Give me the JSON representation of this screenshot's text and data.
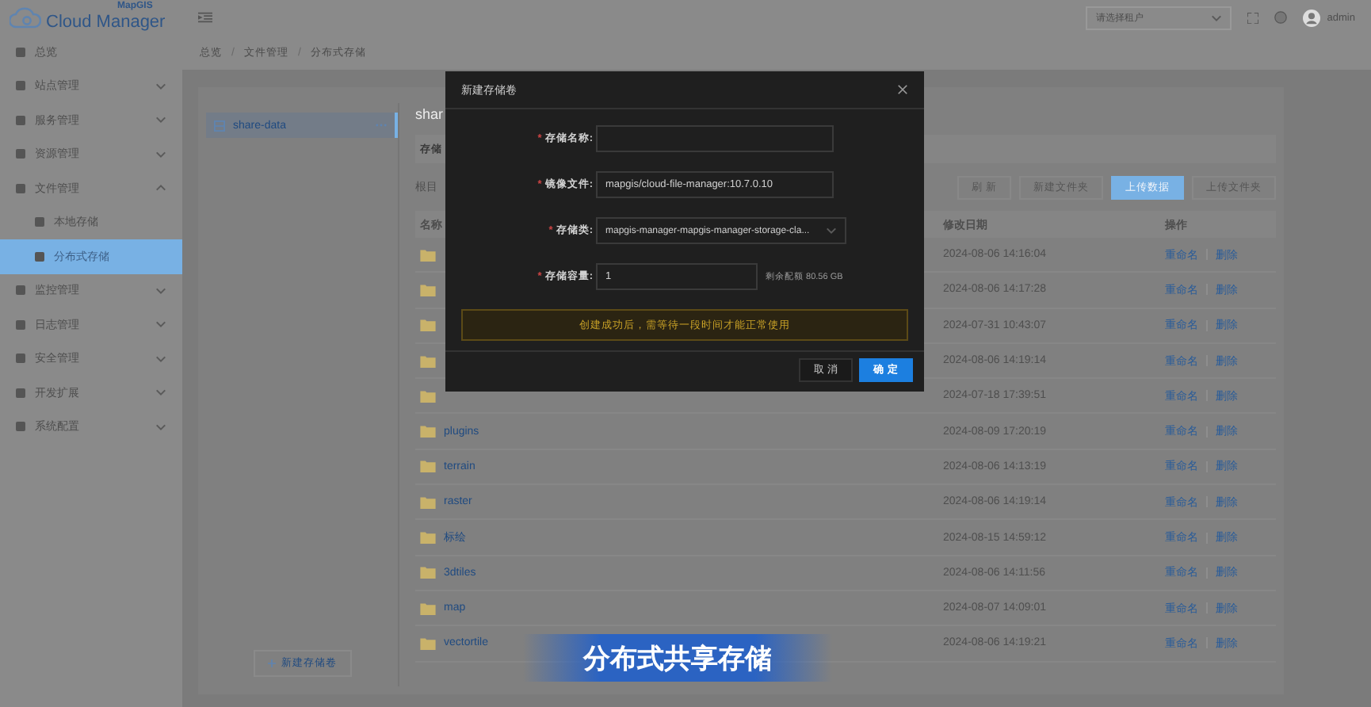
{
  "header": {
    "logo_small": "MapGIS",
    "logo": "Cloud Manager",
    "tenant_select": {
      "placeholder": "请选择租户"
    },
    "user": "admin"
  },
  "breadcrumb": [
    {
      "kind": "item",
      "text": "总览"
    },
    {
      "kind": "separator",
      "text": "/"
    },
    {
      "kind": "item",
      "text": "文件管理"
    },
    {
      "kind": "separator",
      "text": "/"
    },
    {
      "kind": "item",
      "text": "分布式存储"
    }
  ],
  "sidebar": {
    "items": [
      {
        "kind": "link",
        "label": "总览",
        "selected": false
      },
      {
        "kind": "group",
        "label": "站点管理",
        "expanded": false,
        "selected": false
      },
      {
        "kind": "group",
        "label": "服务管理",
        "expanded": false,
        "selected": false
      },
      {
        "kind": "group",
        "label": "资源管理",
        "expanded": false,
        "selected": false
      },
      {
        "kind": "group",
        "label": "文件管理",
        "expanded": true,
        "selected": false,
        "children": [
          {
            "label": "本地存储",
            "selected": false
          },
          {
            "label": "分布式存储",
            "selected": true
          }
        ]
      },
      {
        "kind": "group",
        "label": "监控管理",
        "expanded": false,
        "selected": false
      },
      {
        "kind": "group",
        "label": "日志管理",
        "expanded": false,
        "selected": false
      },
      {
        "kind": "group",
        "label": "安全管理",
        "expanded": false,
        "selected": false
      },
      {
        "kind": "group",
        "label": "开发扩展",
        "expanded": false,
        "selected": false
      },
      {
        "kind": "group",
        "label": "系统配置",
        "expanded": false,
        "selected": false
      }
    ]
  },
  "storage_list": {
    "items": [
      {
        "name": "share-data",
        "selected": true
      }
    ],
    "add_button": "新建存储卷"
  },
  "content": {
    "title": "shar",
    "tab": "存储",
    "path": "根目",
    "buttons": [
      {
        "label": "刷 新",
        "primary": false
      },
      {
        "label": "新建文件夹",
        "primary": false
      },
      {
        "label": "上传数据",
        "primary": true
      },
      {
        "label": "上传文件夹",
        "primary": false
      }
    ],
    "columns": [
      "名称",
      "修改日期",
      "操作"
    ],
    "rows": [
      {
        "modified": "2024-08-06 14:16:04",
        "actions": [
          "重命名",
          "删除"
        ]
      },
      {
        "modified": "2024-08-06 14:17:28",
        "actions": [
          "重命名",
          "删除"
        ]
      },
      {
        "modified": "2024-07-31 10:43:07",
        "actions": [
          "重命名",
          "删除"
        ]
      },
      {
        "modified": "2024-08-06 14:19:14",
        "actions": [
          "重命名",
          "删除"
        ]
      },
      {
        "modified": "2024-07-18 17:39:51",
        "actions": [
          "重命名",
          "删除"
        ]
      },
      {
        "name": "plugins",
        "modified": "2024-08-09 17:20:19",
        "actions": [
          "重命名",
          "删除"
        ]
      },
      {
        "name": "terrain",
        "modified": "2024-08-06 14:13:19",
        "actions": [
          "重命名",
          "删除"
        ]
      },
      {
        "name": "raster",
        "modified": "2024-08-06 14:19:14",
        "actions": [
          "重命名",
          "删除"
        ]
      },
      {
        "name": "标绘",
        "modified": "2024-08-15 14:59:12",
        "actions": [
          "重命名",
          "删除"
        ]
      },
      {
        "name": "3dtiles",
        "modified": "2024-08-06 14:11:56",
        "actions": [
          "重命名",
          "删除"
        ]
      },
      {
        "name": "map",
        "modified": "2024-08-07 14:09:01",
        "actions": [
          "重命名",
          "删除"
        ]
      },
      {
        "name": "vectortile",
        "modified": "2024-08-06 14:19:21",
        "actions": [
          "重命名",
          "删除"
        ]
      }
    ]
  },
  "dialog": {
    "title": "新建存储卷",
    "fields": [
      {
        "kind": "input",
        "label": "存储名称:",
        "required_mark": "*"
      },
      {
        "kind": "input",
        "label": "镜像文件:",
        "required_mark": "*",
        "value": "mapgis/cloud-file-manager:10.7.0.10"
      },
      {
        "kind": "select",
        "label": "存储类:",
        "required_mark": "*",
        "value": "mapgis-manager-mapgis-manager-storage-cla..."
      },
      {
        "kind": "input",
        "label": "存储容量:",
        "required_mark": "*",
        "value": "1",
        "suffix": "剩余配额 80.56 GB"
      }
    ],
    "alert": "创建成功后，需等待一段时间才能正常使用",
    "buttons": [
      {
        "label": "取 消",
        "primary": false
      },
      {
        "label": "确 定",
        "primary": true
      }
    ]
  },
  "caption": "分布式共享存储"
}
